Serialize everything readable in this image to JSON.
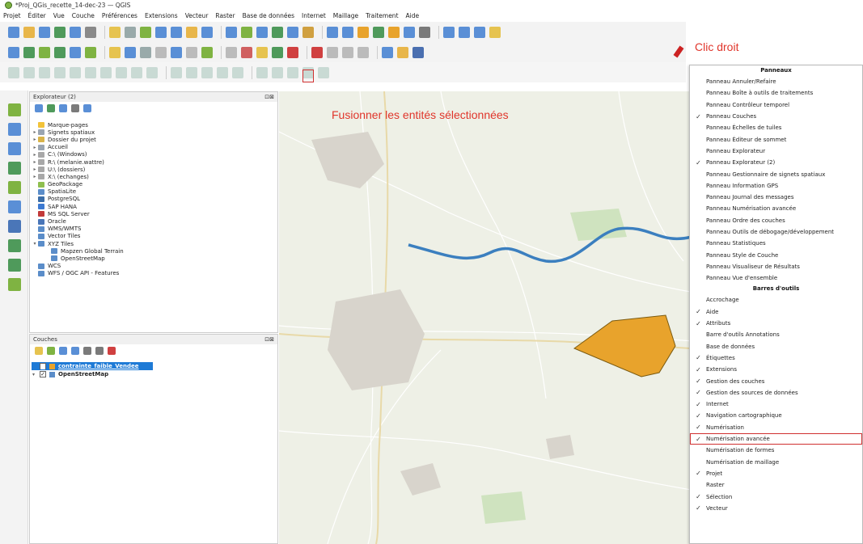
{
  "window": {
    "title": "*Proj_QGis_recette_14-dec-23 — QGIS"
  },
  "menu": [
    "Projet",
    "Éditer",
    "Vue",
    "Couche",
    "Préférences",
    "Extensions",
    "Vecteur",
    "Raster",
    "Base de données",
    "Internet",
    "Maillage",
    "Traitement",
    "Aide"
  ],
  "annotations": {
    "merge": "Fusionner les entités sélectionnées",
    "right_click": "Clic droit"
  },
  "explorer": {
    "title": "Explorateur (2)",
    "items": [
      {
        "label": "Marque-pages",
        "icon": "star-icon",
        "color": "#f2c33a",
        "exp": ""
      },
      {
        "label": "Signets spatiaux",
        "icon": "bookmark-icon",
        "color": "#9aa5b1",
        "exp": "▸"
      },
      {
        "label": "Dossier du projet",
        "icon": "folder-icon",
        "color": "#d9b44a",
        "exp": "▸"
      },
      {
        "label": "Accueil",
        "icon": "home-icon",
        "color": "#9aa5b1",
        "exp": "▸"
      },
      {
        "label": "C:\\ (Windows)",
        "icon": "drive-icon",
        "color": "#a8a8a8",
        "exp": "▸"
      },
      {
        "label": "R:\\ (melanie.wattre)",
        "icon": "drive-icon",
        "color": "#a8a8a8",
        "exp": "▸"
      },
      {
        "label": "U:\\ (dossiers)",
        "icon": "drive-icon",
        "color": "#a8a8a8",
        "exp": "▸"
      },
      {
        "label": "X:\\ (echanges)",
        "icon": "drive-icon",
        "color": "#a8a8a8",
        "exp": "▸"
      },
      {
        "label": "GeoPackage",
        "icon": "geopackage-icon",
        "color": "#8fbf4f",
        "exp": ""
      },
      {
        "label": "SpatiaLite",
        "icon": "spatialite-icon",
        "color": "#5b8dc9",
        "exp": ""
      },
      {
        "label": "PostgreSQL",
        "icon": "postgresql-icon",
        "color": "#3c6ea8",
        "exp": ""
      },
      {
        "label": "SAP HANA",
        "icon": "sap-hana-icon",
        "color": "#3d7ad1",
        "exp": ""
      },
      {
        "label": "MS SQL Server",
        "icon": "mssql-icon",
        "color": "#c23a3a",
        "exp": ""
      },
      {
        "label": "Oracle",
        "icon": "oracle-icon",
        "color": "#4a76b8",
        "exp": ""
      },
      {
        "label": "WMS/WMTS",
        "icon": "wms-icon",
        "color": "#5b8dc9",
        "exp": ""
      },
      {
        "label": "Vector Tiles",
        "icon": "vector-tiles-icon",
        "color": "#5b8dc9",
        "exp": ""
      },
      {
        "label": "XYZ Tiles",
        "icon": "xyz-tiles-icon",
        "color": "#5b8dc9",
        "exp": "▾"
      },
      {
        "label": "Mapzen Global Terrain",
        "icon": "tile-icon",
        "color": "#5b8dc9",
        "exp": "",
        "indent": 2
      },
      {
        "label": "OpenStreetMap",
        "icon": "tile-icon",
        "color": "#5b8dc9",
        "exp": "",
        "indent": 2
      },
      {
        "label": "WCS",
        "icon": "wcs-icon",
        "color": "#5b8dc9",
        "exp": ""
      },
      {
        "label": "WFS / OGC API - Features",
        "icon": "wfs-icon",
        "color": "#5b8dc9",
        "exp": ""
      }
    ]
  },
  "layers": {
    "title": "Couches",
    "items": [
      {
        "label": "contrainte_faible_Vendee",
        "checked": "✓",
        "color": "#e8a32c"
      },
      {
        "label": "OpenStreetMap",
        "checked": "✓",
        "color": "#5b8dc9"
      }
    ]
  },
  "map": {
    "polygon_color": "#e8a32c",
    "river_color": "#3b7fbf",
    "water_color": "#a9cfe6",
    "built_color": "#d8d4cc",
    "background_color": "#eef0e6"
  },
  "context_menu": {
    "panels_title": "Panneaux",
    "panels": [
      {
        "label": "Panneau Annuler/Refaire",
        "checked": ""
      },
      {
        "label": "Panneau Boîte à outils de traitements",
        "checked": ""
      },
      {
        "label": "Panneau Contrôleur temporel",
        "checked": ""
      },
      {
        "label": "Panneau Couches",
        "checked": "✓"
      },
      {
        "label": "Panneau Échelles de tuiles",
        "checked": ""
      },
      {
        "label": "Panneau Éditeur de sommet",
        "checked": ""
      },
      {
        "label": "Panneau Explorateur",
        "checked": ""
      },
      {
        "label": "Panneau Explorateur (2)",
        "checked": "✓"
      },
      {
        "label": "Panneau Gestionnaire de signets spatiaux",
        "checked": ""
      },
      {
        "label": "Panneau Information GPS",
        "checked": ""
      },
      {
        "label": "Panneau Journal des messages",
        "checked": ""
      },
      {
        "label": "Panneau Numérisation avancée",
        "checked": ""
      },
      {
        "label": "Panneau Ordre des couches",
        "checked": ""
      },
      {
        "label": "Panneau Outils de débogage/développement",
        "checked": ""
      },
      {
        "label": "Panneau Statistiques",
        "checked": ""
      },
      {
        "label": "Panneau Style de Couche",
        "checked": ""
      },
      {
        "label": "Panneau Visualiseur de Résultats",
        "checked": ""
      },
      {
        "label": "Panneau Vue d'ensemble",
        "checked": ""
      }
    ],
    "toolbars_title": "Barres d'outils",
    "toolbars": [
      {
        "label": "Accrochage",
        "checked": ""
      },
      {
        "label": "Aide",
        "checked": "✓"
      },
      {
        "label": "Attributs",
        "checked": "✓"
      },
      {
        "label": "Barre d'outils Annotations",
        "checked": ""
      },
      {
        "label": "Base de données",
        "checked": ""
      },
      {
        "label": "Étiquettes",
        "checked": "✓"
      },
      {
        "label": "Extensions",
        "checked": "✓"
      },
      {
        "label": "Gestion des couches",
        "checked": "✓"
      },
      {
        "label": "Gestion des sources de données",
        "checked": "✓"
      },
      {
        "label": "Internet",
        "checked": "✓"
      },
      {
        "label": "Navigation cartographique",
        "checked": "✓"
      },
      {
        "label": "Numérisation",
        "checked": "✓"
      },
      {
        "label": "Numérisation avancée",
        "checked": "✓",
        "boxed": true
      },
      {
        "label": "Numérisation de formes",
        "checked": ""
      },
      {
        "label": "Numérisation de maillage",
        "checked": ""
      },
      {
        "label": "Projet",
        "checked": "✓"
      },
      {
        "label": "Raster",
        "checked": ""
      },
      {
        "label": "Sélection",
        "checked": "✓"
      },
      {
        "label": "Vecteur",
        "checked": "✓"
      }
    ]
  },
  "toolbar_colors": {
    "row1": [
      "#5a8fd6",
      "#e8b64a",
      "#5a8fd6",
      "#4f9a5b",
      "#5a8fd6",
      "#8a8a8a",
      "#e6c34f",
      "#9aa",
      "#7fb342",
      "#5a8fd6",
      "#5a8fd6",
      "#e8b64a",
      "#5a8fd6",
      "#5a8fd6",
      "#7fb342",
      "#5a8fd6",
      "#4f9a5b",
      "#5a8fd6",
      "#d0a040",
      "#5a8fd6",
      "#5a8fd6",
      "#e8a32c",
      "#4f9a5b",
      "#e8a32c",
      "#5a8fd6",
      "#7a7a7a",
      "#5a8fd6",
      "#5a8fd6",
      "#5a8fd6",
      "#e6c34f"
    ],
    "row2": [
      "#5a8fd6",
      "#4f9a5b",
      "#7fb342",
      "#4f9a5b",
      "#5a8fd6",
      "#7fb342",
      "#e6c34f",
      "#5a8fd6",
      "#9aa",
      "#bbb",
      "#5a8fd6",
      "#bbb",
      "#7fb342",
      "#bbb",
      "#d06060",
      "#e6c34f",
      "#4f9a5b",
      "#d04040",
      "#d04040",
      "#bbb",
      "#bbb",
      "#bbb",
      "#5a8fd6",
      "#e8b64a",
      "#4a6fb0"
    ],
    "row3": [
      "#7a9",
      "#7a9",
      "#7a9",
      "#7a9",
      "#7a9",
      "#7a9",
      "#7a9",
      "#7a9",
      "#7a9",
      "#7a9",
      "#7a9",
      "#7a9",
      "#7a9",
      "#7a9",
      "#7a9",
      "#7a9",
      "#7a9",
      "#7a9",
      "#7a9",
      "#7a9"
    ]
  }
}
